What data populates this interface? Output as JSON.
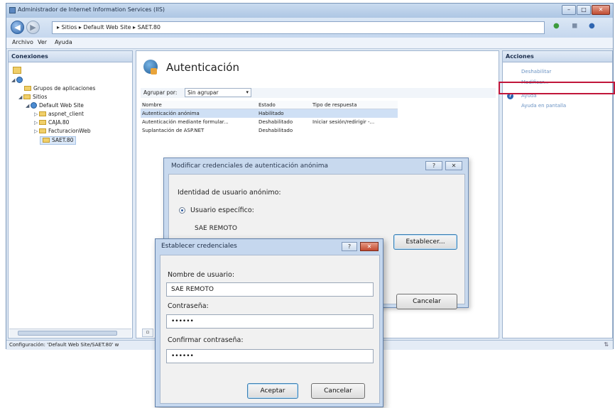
{
  "window": {
    "title": "Administrador de Internet Information Services (IIS)",
    "controls": {
      "minimize": "–",
      "maximize": "□",
      "close": "✕"
    }
  },
  "address": {
    "path": "▸ Sitios ▸ Default Web Site ▸ SAET.80",
    "back_glyph": "◀",
    "forward_glyph": "▶"
  },
  "menu": {
    "items": [
      "Archivo",
      "Ver",
      "Ayuda"
    ]
  },
  "connections": {
    "header": "Conexiones",
    "tree": [
      {
        "label": "Grupos de aplicaciones",
        "kind": "folder"
      },
      {
        "label": "Sitios",
        "kind": "folder"
      },
      {
        "label": "Default Web Site",
        "kind": "globe"
      },
      {
        "label": "aspnet_client",
        "kind": "folder"
      },
      {
        "label": "CAJA.80",
        "kind": "folder"
      },
      {
        "label": "FacturacionWeb",
        "kind": "folder"
      },
      {
        "label": "SAET.80",
        "kind": "folder"
      }
    ]
  },
  "feature": {
    "title": "Autenticación",
    "group_label": "Agrupar por:",
    "group_value": "Sin agrupar",
    "columns": [
      "Nombre",
      "Estado",
      "Tipo de respuesta"
    ],
    "rows": [
      {
        "name": "Autenticación anónima",
        "status": "Habilitado",
        "response": ""
      },
      {
        "name": "Autenticación mediante formular...",
        "status": "Deshabilitado",
        "response": "Iniciar sesión/redirigir -..."
      },
      {
        "name": "Suplantación de ASP.NET",
        "status": "Deshabilitado",
        "response": ""
      }
    ]
  },
  "actions": {
    "header": "Acciones",
    "items": [
      {
        "label": "Deshabilitar"
      },
      {
        "label": "Modificar..."
      },
      {
        "label": "Ayuda"
      },
      {
        "label": "Ayuda en pantalla"
      }
    ]
  },
  "status_bar": {
    "text": "Configuración: 'Default Web Site/SAET.80' w"
  },
  "dialog_modify": {
    "title": "Modificar credenciales de autenticación anónima",
    "help_glyph": "?",
    "close_glyph": "✕",
    "identity_label": "Identidad de usuario anónimo:",
    "radio_label": "Usuario específico:",
    "user_value": "SAE REMOTO",
    "set_button": "Establecer...",
    "cancel_button": "Cancelar"
  },
  "dialog_credentials": {
    "title": "Establecer credenciales",
    "help_glyph": "?",
    "close_glyph": "✕",
    "username_label": "Nombre de usuario:",
    "username_value": "SAE REMOTO",
    "password_label": "Contraseña:",
    "password_value": "••••••",
    "confirm_label": "Confirmar contraseña:",
    "confirm_value": "••••••",
    "accept_button": "Aceptar",
    "cancel_button": "Cancelar"
  },
  "colors": {
    "highlight": "#c0163a",
    "link": "#6b93c3",
    "selection": "#cfe0f5"
  }
}
